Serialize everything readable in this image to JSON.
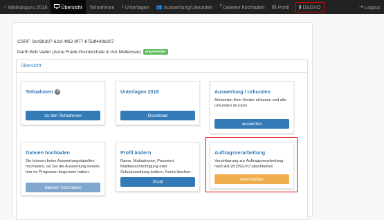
{
  "navbar": {
    "brand": "Minikänguru 2018",
    "items": [
      {
        "label": "Übersicht",
        "icon": "monitor-icon"
      },
      {
        "label": "Teilnahmen",
        "icon": ""
      },
      {
        "label": "Unterlagen",
        "icon": "download-icon"
      },
      {
        "label": "Auswertung/Urkunden",
        "icon": "users-icon"
      },
      {
        "label": "Dateien hochladen",
        "icon": "upload-icon"
      },
      {
        "label": "Profil",
        "icon": "id-card-icon"
      },
      {
        "label": "DSGVO",
        "icon": "document-icon"
      }
    ],
    "logout": "Logout"
  },
  "csrf": "CSRF: 9c42b307-62cf-4f62-9f77-b75df440b307",
  "user": {
    "name": "Darth Bob Vader (Anne Frank-Grundschule in Am Mellensee)",
    "status_badge": "angemeldet"
  },
  "overview": {
    "heading": "Übersicht",
    "cards": {
      "teilnahmen": {
        "title": "Teilnahmen",
        "help": "?",
        "button": "zu den Teilnahmen"
      },
      "unterlagen": {
        "title": "Unterlagen 2018",
        "button": "Download"
      },
      "auswertung": {
        "title": "Auswertung / Urkunden",
        "text": "Antworten Ihrer Kinder erfassen und alle Urkunden drucken",
        "button": "auswerten"
      },
      "dateien": {
        "title": "Dateien hochladen",
        "text": "Sie können keine Auswertungstabellen hochladen, da Sie die Auswertung bereits hier im Programm begonnen haben.",
        "button": "Dateien hochladen"
      },
      "profil": {
        "title": "Profil ändern",
        "text": "Name, Mailadresse, Passwort, Mailbenachrichtigung oder Schulzuordnung ändern, Konto löschen",
        "button": "Profil"
      },
      "auftrag": {
        "title": "Auftragsverarbeitung",
        "text": "Vereinbarung zur Auftragsverarbeitung nach Art.28 DSGVO abschließen",
        "button": "abschließen"
      }
    }
  },
  "colors": {
    "highlight": "#e00000",
    "primary": "#337ab7",
    "warning": "#f0ad4e",
    "success": "#5cb85c"
  }
}
